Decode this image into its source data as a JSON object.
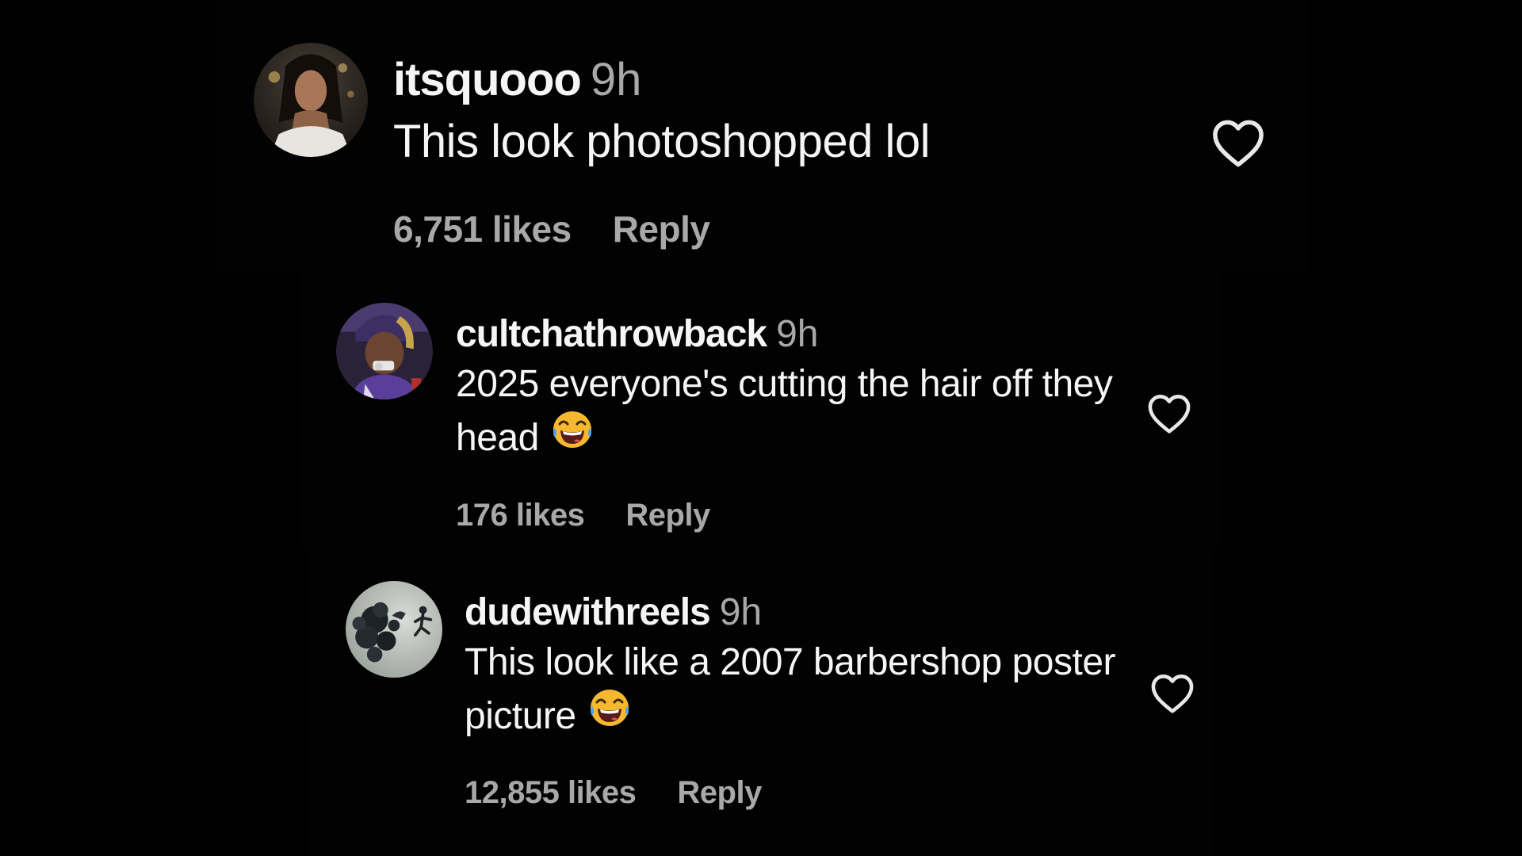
{
  "theme": {
    "background": "#000000",
    "text_primary": "#f5f5f5",
    "text_secondary": "#a8a8a8"
  },
  "comments": [
    {
      "username": "itsquooo",
      "time": "9h",
      "text": "This look photoshopped lol",
      "emoji": "",
      "likes": "6,751 likes",
      "reply": "Reply",
      "avatar_icon": "profile-photo-avatar",
      "like_icon": "heart-outline-icon"
    },
    {
      "username": "cultchathrowback",
      "time": "9h",
      "text": "2025 everyone's cutting the hair off they head",
      "emoji": "face-with-tears-of-joy",
      "likes": "176 likes",
      "reply": "Reply",
      "avatar_icon": "profile-photo-avatar",
      "like_icon": "heart-outline-icon"
    },
    {
      "username": "dudewithreels",
      "time": "9h",
      "text": "This look like a 2007 barbershop poster picture",
      "emoji": "face-with-tears-of-joy",
      "likes": "12,855 likes",
      "reply": "Reply",
      "avatar_icon": "profile-photo-avatar",
      "like_icon": "heart-outline-icon"
    }
  ]
}
